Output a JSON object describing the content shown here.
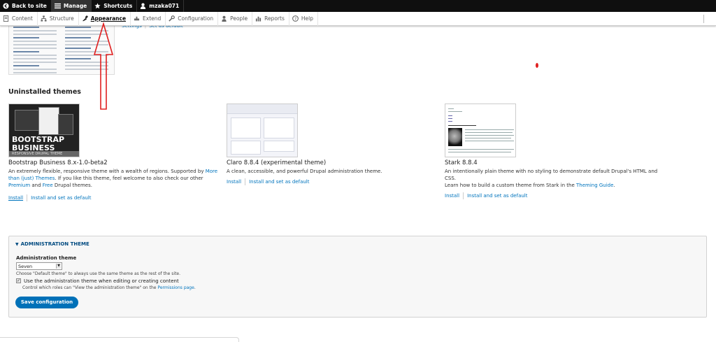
{
  "toolbar": {
    "back": "Back to site",
    "manage": "Manage",
    "shortcuts": "Shortcuts",
    "user": "mzaka071"
  },
  "tray": {
    "items": [
      {
        "label": "Content",
        "icon": "content-icon"
      },
      {
        "label": "Structure",
        "icon": "structure-icon"
      },
      {
        "label": "Appearance",
        "icon": "appearance-icon"
      },
      {
        "label": "Extend",
        "icon": "extend-icon"
      },
      {
        "label": "Configuration",
        "icon": "wrench-icon"
      },
      {
        "label": "People",
        "icon": "people-icon"
      },
      {
        "label": "Reports",
        "icon": "reports-icon"
      },
      {
        "label": "Help",
        "icon": "help-icon"
      }
    ]
  },
  "top_links": {
    "settings": "Settings",
    "set_default": "Set as default"
  },
  "uninstalled": {
    "title": "Uninstalled themes",
    "themes": [
      {
        "name": "Bootstrap Business 8.x-1.0-beta2",
        "desc_1": "An extremely flexible, responsive theme with a wealth of regions. Supported by",
        "link_1": "More than (just) Themes",
        "desc_2": ". If you like this theme, feel welcome to also check our other",
        "link_2": "Premium",
        "desc_3": "and",
        "link_3": "Free",
        "desc_4": "Drupal themes.",
        "thumb_line1": "BOOTSTRAP",
        "thumb_line2": "BUSINESS",
        "thumb_bar": "RESPONSIVE DRUPAL THEME",
        "install": "Install",
        "install_default": "Install and set as default"
      },
      {
        "name": "Claro 8.8.4 (experimental theme)",
        "desc_1": "A clean, accessible, and powerful Drupal administration theme.",
        "install": "Install",
        "install_default": "Install and set as default"
      },
      {
        "name": "Stark 8.8.4",
        "desc_1": "An intentionally plain theme with no styling to demonstrate default Drupal's HTML and CSS.",
        "desc_2": "Learn how to build a custom theme from Stark in the",
        "link_1": "Theming Guide",
        "desc_3": ".",
        "install": "Install",
        "install_default": "Install and set as default"
      }
    ]
  },
  "admin": {
    "legend": "ADMINISTRATION THEME",
    "field_label": "Administration theme",
    "selected": "Seven",
    "help": "Choose \"Default theme\" to always use the same theme as the rest of the site.",
    "checkbox_label": "Use the administration theme when editing or creating content",
    "checkbox_checked": true,
    "checkbox_help_1": "Control which roles can \"View the administration theme\" on the",
    "checkbox_help_link": "Permissions page",
    "checkbox_help_2": ".",
    "save": "Save configuration"
  },
  "colors": {
    "toolbar_bg": "#0f0f0f",
    "link": "#0074bd",
    "button": "#0071b8",
    "annotation": "#e02020"
  }
}
